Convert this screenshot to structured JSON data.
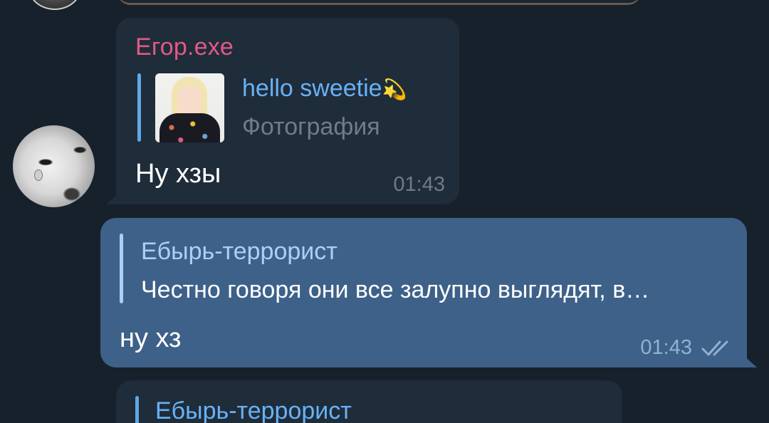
{
  "messages": [
    {
      "direction": "incoming",
      "sender": "Егор.exe",
      "reply": {
        "title": "hello sweetie",
        "title_emoji": "💫",
        "subtitle": "Фотография"
      },
      "text": "Ну хзы",
      "time": "01:43"
    },
    {
      "direction": "outgoing",
      "reply": {
        "title": "Ебырь-террорист",
        "text": "Честно говоря они все залупно выглядят, в…"
      },
      "text": "ну хз",
      "time": "01:43",
      "status_icon": "double-check-icon"
    },
    {
      "direction": "incoming",
      "partial_reply_title": "Ебырь-террорист"
    }
  ],
  "colors": {
    "background": "#17212b",
    "incoming_bubble": "#1f2c3a",
    "outgoing_bubble": "#3e6189",
    "sender_name": "#e05a86",
    "reply_link": "#68b2f5"
  }
}
